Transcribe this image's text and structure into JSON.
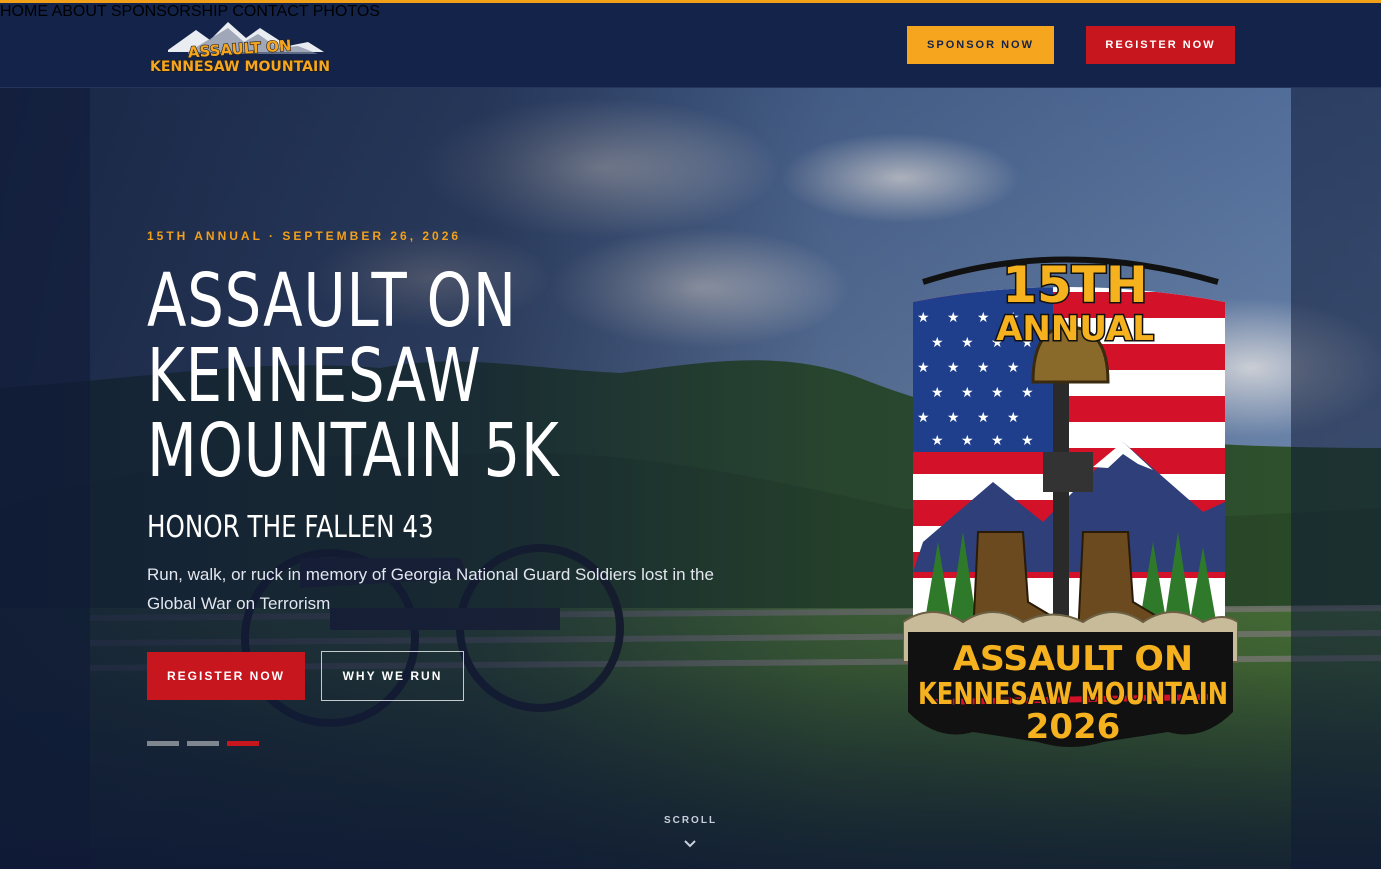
{
  "header": {
    "logo_text_line1": "ASSAULT ON",
    "logo_text_line2": "KENNESAW MOUNTAIN",
    "nav": [
      {
        "label": "HOME"
      },
      {
        "label": "ABOUT"
      },
      {
        "label": "SPONSORSHIP"
      },
      {
        "label": "CONTACT"
      },
      {
        "label": "PHOTOS"
      }
    ],
    "sponsor_button": "SPONSOR NOW",
    "register_button": "REGISTER NOW"
  },
  "hero": {
    "eyebrow": "15TH ANNUAL · SEPTEMBER 26, 2026",
    "title": "ASSAULT ON KENNESAW MOUNTAIN 5K",
    "subtitle": "HONOR THE FALLEN 43",
    "description": "Run, walk, or ruck in memory of Georgia National Guard Soldiers lost in the Global War on Terrorism",
    "register_button": "REGISTER NOW",
    "why_button": "WHY WE RUN",
    "slides_total": 3,
    "slide_active": 3,
    "scroll_label": "SCROLL"
  },
  "badge": {
    "top_line1": "15TH",
    "top_line2": "ANNUAL",
    "bottom_line1": "ASSAULT ON",
    "bottom_line2": "KENNESAW MOUNTAIN",
    "bottom_line3": "2026"
  },
  "colors": {
    "navy": "#13234a",
    "gold": "#f6a51f",
    "red": "#c8161e"
  },
  "icons": [
    "mountain-logo-icon",
    "chevron-down-icon",
    "star-icon",
    "helmet-icon",
    "rifle-icon",
    "boots-icon"
  ]
}
